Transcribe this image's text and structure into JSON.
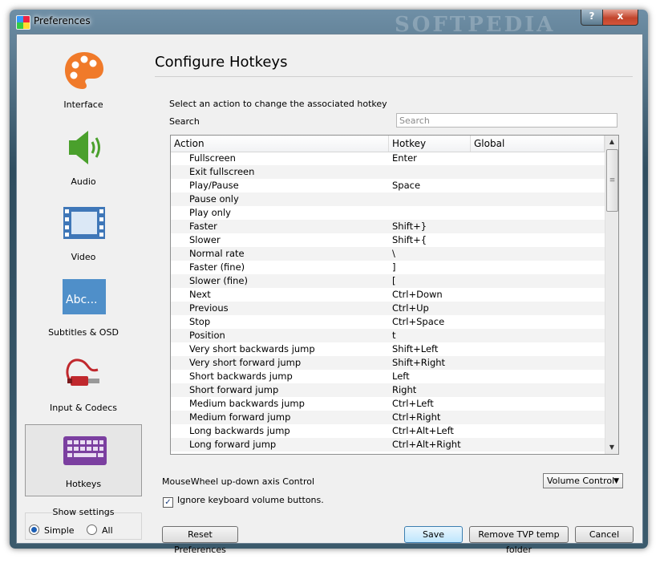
{
  "window": {
    "title": "Preferences",
    "help_label": "?",
    "close_label": "x",
    "watermark": "SOFTPEDIA"
  },
  "sidebar": {
    "items": [
      {
        "label": "Interface",
        "icon": "palette-icon"
      },
      {
        "label": "Audio",
        "icon": "speaker-icon"
      },
      {
        "label": "Video",
        "icon": "film-icon"
      },
      {
        "label": "Subtitles & OSD",
        "icon": "abc-icon"
      },
      {
        "label": "Input & Codecs",
        "icon": "cable-plug-icon"
      },
      {
        "label": "Hotkeys",
        "icon": "keyboard-icon"
      }
    ],
    "selected": "Hotkeys"
  },
  "show_settings": {
    "label": "Show settings",
    "options": [
      "Simple",
      "All"
    ],
    "selected": "Simple"
  },
  "main": {
    "heading": "Configure Hotkeys",
    "instruction": "Select an action to change the associated hotkey",
    "search_label": "Search",
    "search_placeholder": "Search",
    "table": {
      "columns": [
        "Action",
        "Hotkey",
        "Global"
      ],
      "rows": [
        {
          "action": "Fullscreen",
          "hotkey": "Enter",
          "global": ""
        },
        {
          "action": "Exit fullscreen",
          "hotkey": "",
          "global": ""
        },
        {
          "action": "Play/Pause",
          "hotkey": "Space",
          "global": ""
        },
        {
          "action": "Pause only",
          "hotkey": "",
          "global": ""
        },
        {
          "action": "Play only",
          "hotkey": "",
          "global": ""
        },
        {
          "action": "Faster",
          "hotkey": "Shift+}",
          "global": ""
        },
        {
          "action": "Slower",
          "hotkey": "Shift+{",
          "global": ""
        },
        {
          "action": "Normal rate",
          "hotkey": "\\",
          "global": ""
        },
        {
          "action": "Faster (fine)",
          "hotkey": "]",
          "global": ""
        },
        {
          "action": "Slower (fine)",
          "hotkey": "[",
          "global": ""
        },
        {
          "action": "Next",
          "hotkey": "Ctrl+Down",
          "global": ""
        },
        {
          "action": "Previous",
          "hotkey": "Ctrl+Up",
          "global": ""
        },
        {
          "action": "Stop",
          "hotkey": "Ctrl+Space",
          "global": ""
        },
        {
          "action": "Position",
          "hotkey": "t",
          "global": ""
        },
        {
          "action": "Very short backwards jump",
          "hotkey": "Shift+Left",
          "global": ""
        },
        {
          "action": "Very short forward jump",
          "hotkey": "Shift+Right",
          "global": ""
        },
        {
          "action": "Short backwards jump",
          "hotkey": "Left",
          "global": ""
        },
        {
          "action": "Short forward jump",
          "hotkey": "Right",
          "global": ""
        },
        {
          "action": "Medium backwards jump",
          "hotkey": "Ctrl+Left",
          "global": ""
        },
        {
          "action": "Medium forward jump",
          "hotkey": "Ctrl+Right",
          "global": ""
        },
        {
          "action": "Long backwards jump",
          "hotkey": "Ctrl+Alt+Left",
          "global": ""
        },
        {
          "action": "Long forward jump",
          "hotkey": "Ctrl+Alt+Right",
          "global": ""
        }
      ]
    },
    "mousewheel_label": "MouseWheel up-down axis Control",
    "mousewheel_value": "Volume Control",
    "ignore_volume_label": "Ignore keyboard volume buttons.",
    "ignore_volume_checked": true
  },
  "buttons": {
    "reset": "Reset Preferences",
    "save": "Save",
    "remove_temp": "Remove TVP temp folder",
    "cancel": "Cancel"
  },
  "colors": {
    "palette_orange": "#f07a2a",
    "speaker_green": "#4aa02c",
    "film_blue": "#3f77b8",
    "abc_blue": "#4f8fc9",
    "keyboard_purple": "#7b3fa0",
    "cable_red": "#c0282d"
  }
}
